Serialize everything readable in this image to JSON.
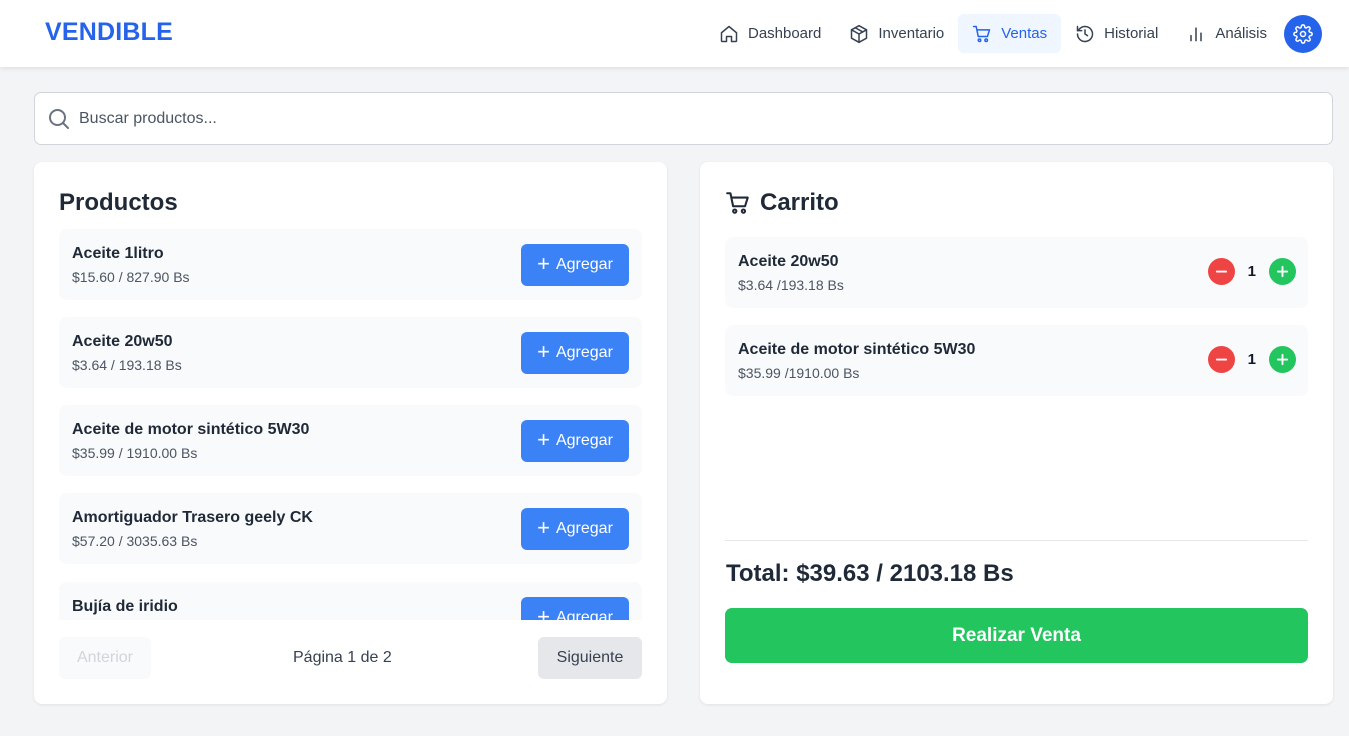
{
  "app": {
    "brand": "VENDIBLE"
  },
  "nav": {
    "items": [
      {
        "label": "Dashboard",
        "icon": "home-icon",
        "active": false
      },
      {
        "label": "Inventario",
        "icon": "package-icon",
        "active": false
      },
      {
        "label": "Ventas",
        "icon": "cart-icon",
        "active": true
      },
      {
        "label": "Historial",
        "icon": "history-icon",
        "active": false
      },
      {
        "label": "Análisis",
        "icon": "bar-chart-icon",
        "active": false
      }
    ],
    "settings_icon": "gear-icon"
  },
  "search": {
    "placeholder": "Buscar productos...",
    "value": ""
  },
  "products": {
    "title": "Productos",
    "add_label": "Agregar",
    "items": [
      {
        "name": "Aceite 1litro",
        "price": "$15.60 / 827.90 Bs"
      },
      {
        "name": "Aceite 20w50",
        "price": "$3.64 / 193.18 Bs"
      },
      {
        "name": "Aceite de motor sintético 5W30",
        "price": "$35.99 / 1910.00 Bs"
      },
      {
        "name": "Amortiguador Trasero geely CK",
        "price": "$57.20 / 3035.63 Bs"
      },
      {
        "name": "Bujía de iridio",
        "price": ""
      }
    ],
    "pagination": {
      "prev": "Anterior",
      "info": "Página 1 de 2",
      "next": "Siguiente"
    }
  },
  "cart": {
    "title": "Carrito",
    "items": [
      {
        "name": "Aceite 20w50",
        "price": "$3.64 /193.18 Bs",
        "qty": "1"
      },
      {
        "name": "Aceite de motor sintético 5W30",
        "price": "$35.99 /1910.00 Bs",
        "qty": "1"
      }
    ],
    "total": "Total: $39.63 / 2103.18 Bs",
    "checkout_label": "Realizar Venta"
  },
  "colors": {
    "brand": "#2563eb",
    "add_button": "#3b82f6",
    "checkout": "#22c55e",
    "minus": "#ef4444",
    "plus": "#22c55e"
  }
}
